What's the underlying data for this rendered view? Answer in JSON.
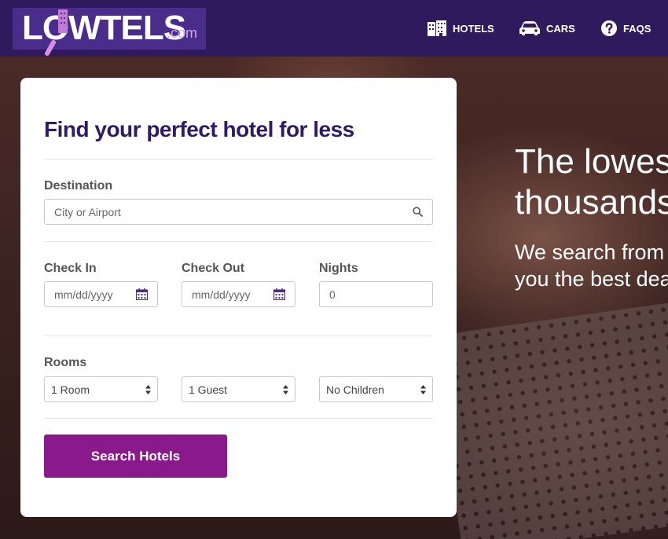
{
  "header": {
    "logo_text": "LOWTELS",
    "logo_suffix": ".com",
    "nav": [
      {
        "label": "HOTELS",
        "icon": "hotel-icon"
      },
      {
        "label": "CARS",
        "icon": "car-icon"
      },
      {
        "label": "FAQS",
        "icon": "question-icon"
      }
    ]
  },
  "hero": {
    "headline": [
      "The lowes",
      "thousands"
    ],
    "subhead": [
      "We search from",
      "you the best dea"
    ]
  },
  "form": {
    "title": "Find your perfect hotel for less",
    "destination": {
      "label": "Destination",
      "placeholder": "City or Airport"
    },
    "check_in": {
      "label": "Check In",
      "placeholder": "mm/dd/yyyy"
    },
    "check_out": {
      "label": "Check Out",
      "placeholder": "mm/dd/yyyy"
    },
    "nights": {
      "label": "Nights",
      "value": "0"
    },
    "rooms": {
      "label": "Rooms",
      "rooms_value": "1 Room",
      "guests_value": "1 Guest",
      "children_value": "No Children"
    },
    "submit_label": "Search Hotels"
  },
  "colors": {
    "brand_purple": "#2e1a5c",
    "button_magenta": "#8a1a8c",
    "title_purple": "#2f1a63"
  }
}
